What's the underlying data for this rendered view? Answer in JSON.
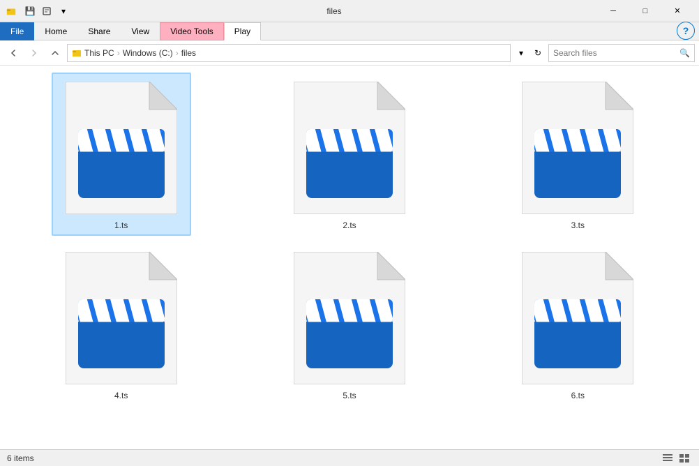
{
  "titleBar": {
    "title": "files",
    "quickAccessIcons": [
      "save-icon",
      "undo-icon",
      "redo-icon"
    ],
    "windowControls": [
      "minimize",
      "maximize",
      "close"
    ]
  },
  "ribbonTabs": [
    {
      "id": "file",
      "label": "File",
      "style": "file"
    },
    {
      "id": "home",
      "label": "Home"
    },
    {
      "id": "share",
      "label": "Share"
    },
    {
      "id": "view",
      "label": "View"
    },
    {
      "id": "videotools",
      "label": "Video Tools",
      "style": "highlight"
    },
    {
      "id": "play",
      "label": "Play",
      "style": "active"
    }
  ],
  "navigation": {
    "backDisabled": false,
    "forwardDisabled": true,
    "upDisabled": false,
    "breadcrumbs": [
      "This PC",
      "Windows (C:)",
      "files"
    ],
    "searchPlaceholder": "Search files"
  },
  "files": [
    {
      "name": "1.ts",
      "selected": true
    },
    {
      "name": "2.ts",
      "selected": false
    },
    {
      "name": "3.ts",
      "selected": false
    },
    {
      "name": "4.ts",
      "selected": false
    },
    {
      "name": "5.ts",
      "selected": false
    },
    {
      "name": "6.ts",
      "selected": false
    }
  ],
  "statusBar": {
    "itemCount": "6 items"
  },
  "colors": {
    "accent": "#1e6dc0",
    "fileBlue": "#1a73e8",
    "fileDark": "#0056c7",
    "pageWhite": "#f5f5f5",
    "pageEdge": "#d0d0d0",
    "clapperStripe": "#2b8fe8"
  }
}
